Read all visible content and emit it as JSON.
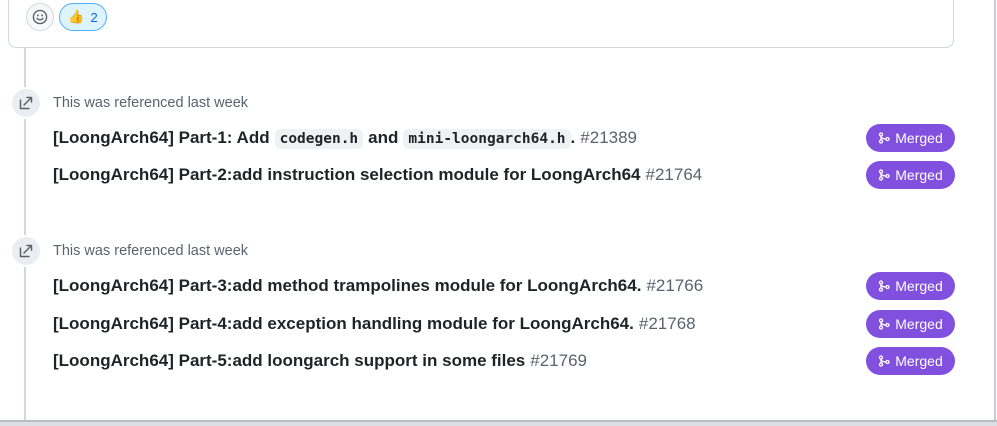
{
  "reactions": {
    "picker_icon": "smiley-icon",
    "thumbs_up": {
      "emoji": "👍",
      "count": "2"
    }
  },
  "groups": [
    {
      "header": "This was referenced last week",
      "items": [
        {
          "prefix": "[LoongArch64] Part-1: Add",
          "code1": "codegen.h",
          "mid": "and",
          "code2": "mini-loongarch64.h",
          "suffix": ".",
          "number": "#21389",
          "status": "Merged"
        },
        {
          "title": "[LoongArch64] Part-2:add instruction selection module for LoongArch64",
          "number": "#21764",
          "status": "Merged"
        }
      ]
    },
    {
      "header": "This was referenced last week",
      "items": [
        {
          "title": "[LoongArch64] Part-3:add method trampolines module for LoongArch64.",
          "number": "#21766",
          "status": "Merged"
        },
        {
          "title": "[LoongArch64] Part-4:add exception handling module for LoongArch64.",
          "number": "#21768",
          "status": "Merged"
        },
        {
          "title": "[LoongArch64] Part-5:add loongarch support in some files",
          "number": "#21769",
          "status": "Merged"
        }
      ]
    }
  ],
  "colors": {
    "merged": "#8250df",
    "reaction_bg": "#ddf4ff",
    "reaction_border": "#54aeff"
  }
}
